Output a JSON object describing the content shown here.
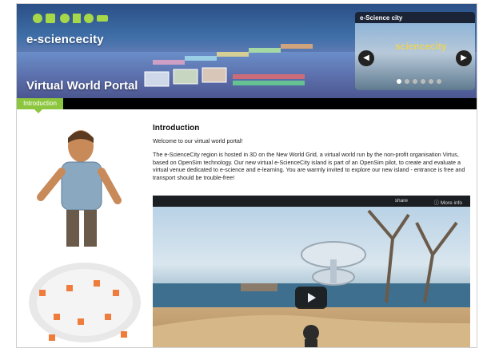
{
  "brand": {
    "logo_text": "e-sciencecity",
    "portal_title": "Virtual World Portal"
  },
  "slider": {
    "caption": "e-Science city",
    "overlay_text": "sciencecity",
    "prev_label": "◀",
    "next_label": "▶",
    "dots": 6,
    "active_dot": 0
  },
  "nav": {
    "tabs": [
      {
        "label": "Introduction",
        "active": true
      }
    ],
    "accent": "#8cc63f"
  },
  "main": {
    "heading": "Introduction",
    "welcome": "Welcome to our virtual world portal!",
    "body": "The e-ScienceCity region is hosted in 3D on the New World Grid, a virtual world run by the non-profit organisation Virtus, based on OpenSim technology. Our new virtual e-ScienceCity island is part of an OpenSim pilot, to create and evaluate a virtual venue dedicated to e-science and e-learning. You are warmly invited to explore our new island - entrance is free and transport should be trouble-free!"
  },
  "video": {
    "share_label": "share",
    "more_info_label": "More info"
  },
  "icons": {
    "play": "play-icon",
    "arrow_prev": "chevron-left-icon",
    "arrow_next": "chevron-right-icon",
    "more_info": "info-icon"
  }
}
